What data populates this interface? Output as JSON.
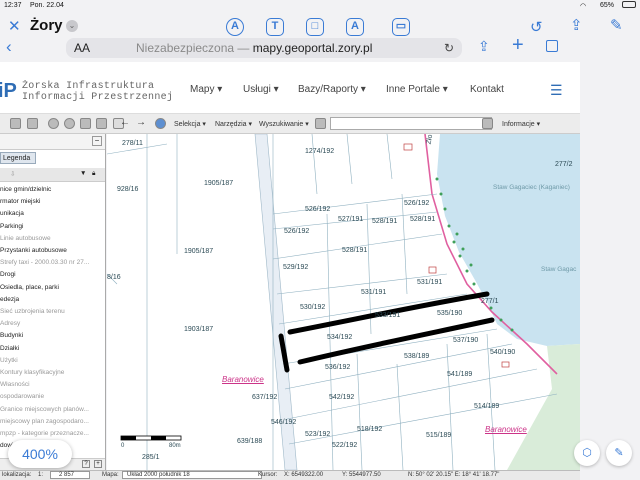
{
  "status": {
    "time": "12:37",
    "date": "Pon. 22.04",
    "battery": "65%"
  },
  "markup": {
    "doc_title": "Żory"
  },
  "browser": {
    "aa": "AA",
    "url_prefix": "Niezabezpieczona — ",
    "url": "mapy.geoportal.zory.pl"
  },
  "site": {
    "logo_mark": "iP",
    "logo_line1": "Żorska Infrastruktura",
    "logo_line2": "Informacji Przestrzennej",
    "nav": [
      "Mapy ▾",
      "Usługi ▾",
      "Bazy/Raporty ▾",
      "Inne Portale ▾",
      "Kontakt"
    ]
  },
  "toolbar": {
    "selekcja": "Selekcja ▾",
    "narzedzia": "Narzędzia ▾",
    "wyszukiwanie": "Wyszukiwanie ▾",
    "informacje": "Informacje ▾"
  },
  "legend": {
    "tab": "Legenda",
    "items": [
      {
        "label": "nice gmin/dzielnic",
        "on": true
      },
      {
        "label": "rmator miejski",
        "on": true
      },
      {
        "label": "unikacja",
        "on": true
      },
      {
        "label": "Parkingi",
        "on": true
      },
      {
        "label": "Linie autobusowe",
        "on": false
      },
      {
        "label": "Przystanki autobusowe",
        "on": true
      },
      {
        "label": "Strefy taxi - 2000.03.30 nr 27...",
        "on": false
      },
      {
        "label": "Drogi",
        "on": true
      },
      {
        "label": "Osiedla, place, parki",
        "on": true
      },
      {
        "label": "edezja",
        "on": true
      },
      {
        "label": "Sieć uzbrojenia terenu",
        "on": false
      },
      {
        "label": "Adresy",
        "on": false
      },
      {
        "label": "Budynki",
        "on": true
      },
      {
        "label": "Działki",
        "on": true
      },
      {
        "label": "Użytki",
        "on": false
      },
      {
        "label": "Kontury klasyfikacyjne",
        "on": false
      },
      {
        "label": "Własności",
        "on": false
      },
      {
        "label": "ospodarowanie",
        "on": false
      },
      {
        "label": "Granice miejscowych planów...",
        "on": false
      },
      {
        "label": "miejscowy plan zagospodaro...",
        "on": false
      },
      {
        "label": "mpzp - kategorie przeznacze...",
        "on": false
      },
      {
        "label": "dowi",
        "on": true
      }
    ]
  },
  "zoom_badge": "400%",
  "map": {
    "parcels": [
      {
        "id": "278/11"
      },
      {
        "id": "1274/192"
      },
      {
        "id": "1905/187"
      },
      {
        "id": "928/16"
      },
      {
        "id": "526/192"
      },
      {
        "id": "526/192"
      },
      {
        "id": "527/191"
      },
      {
        "id": "528/191"
      },
      {
        "id": "528/191"
      },
      {
        "id": "528/191"
      },
      {
        "id": "526/192"
      },
      {
        "id": "1905/187"
      },
      {
        "id": "529/192"
      },
      {
        "id": "531/191"
      },
      {
        "id": "531/191"
      },
      {
        "id": "530/192"
      },
      {
        "id": "533/191"
      },
      {
        "id": "535/190"
      },
      {
        "id": "1903/187"
      },
      {
        "id": "534/192"
      },
      {
        "id": "537/190"
      },
      {
        "id": "540/190"
      },
      {
        "id": "538/189"
      },
      {
        "id": "536/192"
      },
      {
        "id": "541/189"
      },
      {
        "id": "637/192"
      },
      {
        "id": "542/192"
      },
      {
        "id": "514/189"
      },
      {
        "id": "546/192"
      },
      {
        "id": "518/192"
      },
      {
        "id": "523/192"
      },
      {
        "id": "515/189"
      },
      {
        "id": "639/188"
      },
      {
        "id": "522/192"
      },
      {
        "id": "277/2"
      },
      {
        "id": "277/1"
      },
      {
        "id": "8/16"
      },
      {
        "id": "285/1"
      }
    ],
    "places": [
      "Baranowice",
      "Baranowice"
    ],
    "lakes": [
      "Staw Gagaciec (Kaganiec)",
      "Staw Gagac"
    ],
    "street": "Zło",
    "scale": {
      "zero": "0",
      "end": "80m"
    }
  },
  "bottom": {
    "label1": "lokalizacja:",
    "scale_prefix": "1:",
    "scale": "2 857",
    "label2": "Mapa:",
    "crs": "Układ 2000 południk 18",
    "cursor": "Kursor:",
    "coord_x": "X: 6549322.00",
    "coord_y": "Y: 5544977.50",
    "coord_geo": "N: 50° 02' 20.15\" E: 18° 41' 18.77\""
  }
}
